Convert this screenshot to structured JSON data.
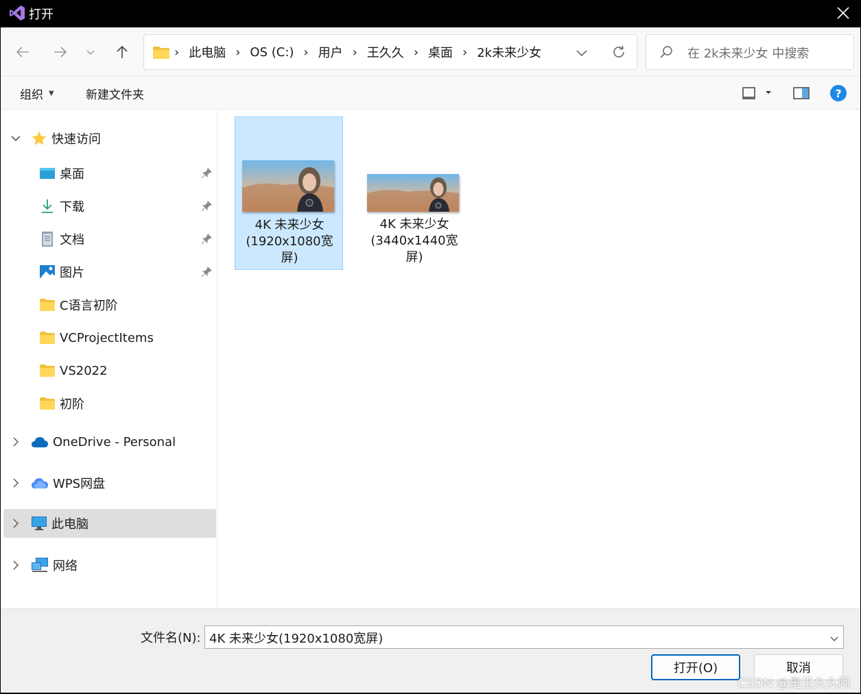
{
  "window": {
    "title": "打开",
    "close_icon": "close-icon",
    "app_icon": "visual-studio-icon"
  },
  "navigation": {
    "back_icon": "arrow-left-icon",
    "forward_icon": "arrow-right-icon",
    "recent_icon": "chevron-down-icon",
    "up_icon": "arrow-up-icon"
  },
  "address": {
    "crumbs": [
      "此电脑",
      "OS (C:)",
      "用户",
      "王久久",
      "桌面",
      "2k未来少女"
    ],
    "dropdown_icon": "chevron-down-icon",
    "refresh_icon": "refresh-icon"
  },
  "search": {
    "placeholder": "在 2k未来少女 中搜索"
  },
  "toolbar": {
    "organize": "组织",
    "new_folder": "新建文件夹"
  },
  "sidebar": {
    "quick_access": "快速访问",
    "pinned": [
      {
        "label": "桌面",
        "icon": "desktop-icon"
      },
      {
        "label": "下载",
        "icon": "download-icon"
      },
      {
        "label": "文档",
        "icon": "document-icon"
      },
      {
        "label": "图片",
        "icon": "pictures-icon"
      }
    ],
    "folders": [
      "C语言初阶",
      "VCProjectItems",
      "VS2022",
      "初阶"
    ],
    "onedrive": "OneDrive - Personal",
    "wps": "WPS网盘",
    "this_pc": "此电脑",
    "network": "网络"
  },
  "files": [
    {
      "name": "4K 未来少女(1920x1080宽屏)",
      "selected": true
    },
    {
      "name": "4K 未来少女(3440x1440宽屏)",
      "selected": false
    }
  ],
  "footer": {
    "filename_label": "文件名(N):",
    "filename_value": "4K 未来少女(1920x1080宽屏)",
    "open_button": "打开(O)",
    "cancel_button": "取消",
    "watermark": "CSDN @是王久久阿"
  }
}
